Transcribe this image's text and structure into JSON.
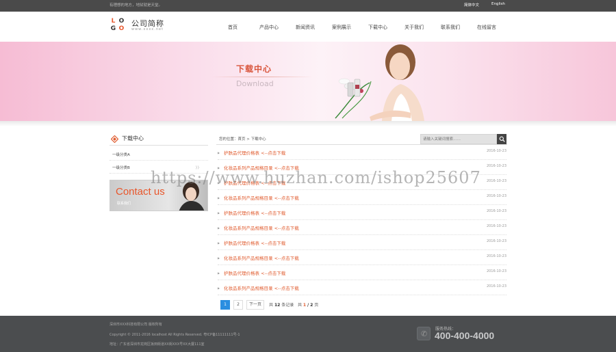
{
  "topbar": {
    "slogan": "有理想的地方，地狱就是天堂。",
    "lang_cn": "简体中文",
    "lang_en": "English"
  },
  "header": {
    "logo_letters": [
      "L",
      "O",
      "G",
      "O"
    ],
    "logo_name": "公司简称",
    "logo_url": "www.xxxx.net",
    "nav": [
      "首页",
      "产品中心",
      "新闻资讯",
      "案例展示",
      "下载中心",
      "关于我们",
      "联系我们",
      "在线留言"
    ]
  },
  "banner": {
    "title": "下载中心",
    "subtitle": "Download"
  },
  "sidebar": {
    "title": "下载中心",
    "items": [
      {
        "label": "一级分类A",
        "arrow": ""
      },
      {
        "label": "一级分类B",
        "arrow": "〉〉"
      }
    ],
    "contact_title": "Contact us",
    "contact_sub": "联系我们"
  },
  "main": {
    "breadcrumb": "您的位置：首页 > 下载中心",
    "search_placeholder": "请输入关键词搜索……",
    "rows": [
      {
        "title": "护肤品代理价格表 <--点击下载",
        "date": "2016-10-23"
      },
      {
        "title": "化妆品系列产品规格目录 <--点击下载",
        "date": "2016-10-23"
      },
      {
        "title": "护肤品代理价格表 <--点击下载",
        "date": "2016-10-23"
      },
      {
        "title": "化妆品系列产品规格目录 <--点击下载",
        "date": "2016-10-23"
      },
      {
        "title": "护肤品代理价格表 <--点击下载",
        "date": "2016-10-23"
      },
      {
        "title": "化妆品系列产品规格目录 <--点击下载",
        "date": "2016-10-23"
      },
      {
        "title": "护肤品代理价格表 <--点击下载",
        "date": "2016-10-23"
      },
      {
        "title": "化妆品系列产品规格目录 <--点击下载",
        "date": "2016-10-23"
      },
      {
        "title": "护肤品代理价格表 <--点击下载",
        "date": "2016-10-23"
      },
      {
        "title": "化妆品系列产品规格目录 <--点击下载",
        "date": "2016-10-23"
      }
    ],
    "pager": {
      "page1": "1",
      "page2": "2",
      "next": "下一页",
      "total_prefix": "共",
      "total_count": "12",
      "total_suffix": "条记录",
      "page_prefix": "共",
      "current": "1",
      "sep": "/",
      "total_pages": "2",
      "page_suffix": "页"
    }
  },
  "watermark": "https://www.huzhan.com/ishop25607",
  "footer": {
    "line1": "深圳市XXX科技有限公司 版权所有",
    "line2": "Copyright © 2011-2016   localhost All Rights Reserved.  粤ICP备11111111号-1",
    "line3": "地址：广东省深圳市龙岗区坂田街道XX街XXX号XX大厦111室",
    "hotline_label": "服务热线：",
    "hotline": "400-400-4000"
  },
  "colors": {
    "accent": "#e05b2e",
    "banner_title": "#d9553c",
    "topbar": "#4a4a4a",
    "footer": "#4b4d4f",
    "pager_active": "#2a8ee0"
  }
}
